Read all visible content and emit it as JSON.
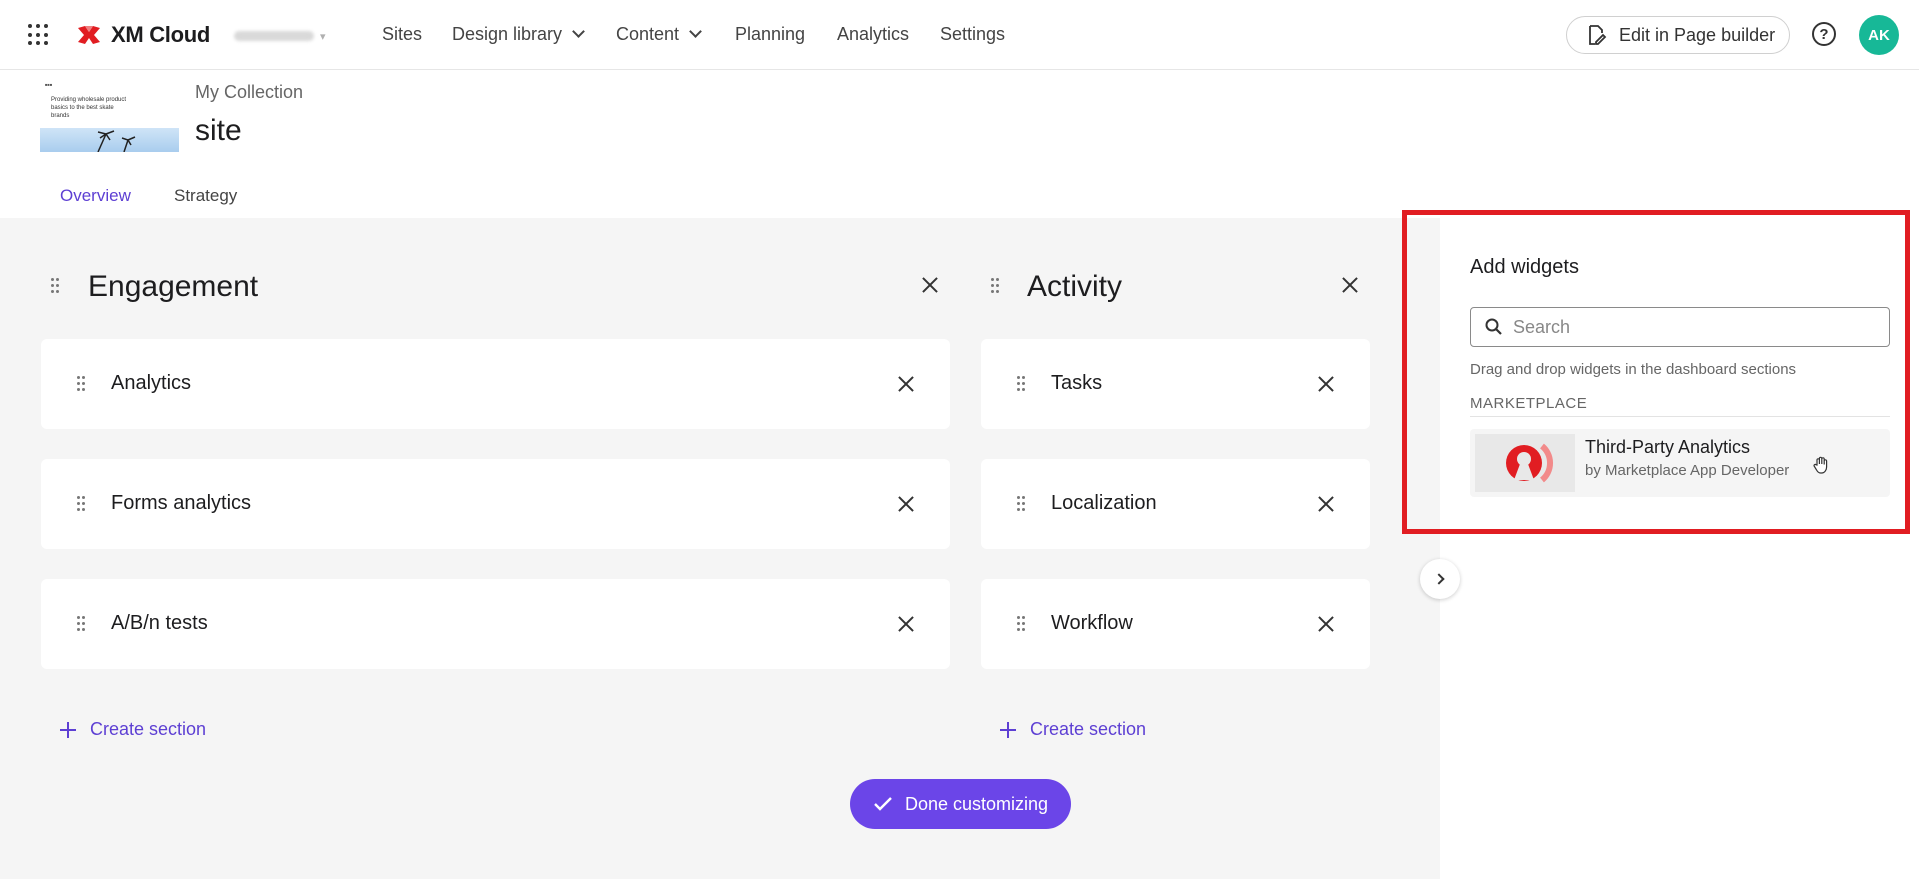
{
  "header": {
    "brand": "XM Cloud",
    "nav": [
      {
        "label": "Sites",
        "has_menu": false
      },
      {
        "label": "Design library",
        "has_menu": true
      },
      {
        "label": "Content",
        "has_menu": true
      },
      {
        "label": "Planning",
        "has_menu": false
      },
      {
        "label": "Analytics",
        "has_menu": false
      },
      {
        "label": "Settings",
        "has_menu": false
      }
    ],
    "edit_button": "Edit in Page builder",
    "help": "?",
    "avatar_initials": "AK"
  },
  "site": {
    "collection": "My Collection",
    "title": "site",
    "thumbnail_text": "Providing wholesale product basics to the best skate brands",
    "tabs": [
      {
        "label": "Overview",
        "active": true
      },
      {
        "label": "Strategy",
        "active": false
      }
    ]
  },
  "sections": [
    {
      "title": "Engagement",
      "widgets": [
        "Analytics",
        "Forms analytics",
        "A/B/n tests"
      ],
      "create_label": "Create section"
    },
    {
      "title": "Activity",
      "widgets": [
        "Tasks",
        "Localization",
        "Workflow"
      ],
      "create_label": "Create section"
    }
  ],
  "done_button": "Done customizing",
  "widgets_panel": {
    "title": "Add widgets",
    "search_placeholder": "Search",
    "hint": "Drag and drop widgets in the dashboard sections",
    "marketplace_label": "MARKETPLACE",
    "items": [
      {
        "name": "Third-Party Analytics",
        "by": "by Marketplace App Developer"
      }
    ]
  },
  "colors": {
    "accent": "#5d3fd3",
    "button": "#6b45e8",
    "highlight": "#e11d22",
    "avatar": "#17b897"
  }
}
